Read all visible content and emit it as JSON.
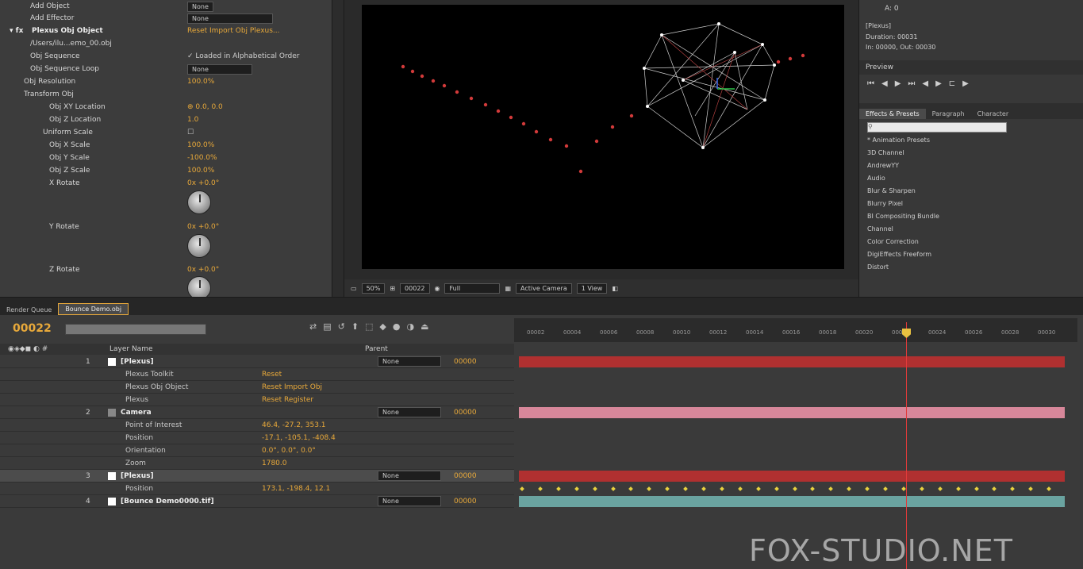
{
  "effect_controls": {
    "top_rows": [
      {
        "name": "Add Object",
        "value": "None"
      },
      {
        "name": "Add Effector",
        "value": "None"
      }
    ],
    "group_title": "Plexus Obj Object",
    "group_value": "Reset   Import Obj   Plexus...",
    "path": "/Users/ilu...emo_00.obj",
    "obj_sequence_label": "Obj Sequence",
    "obj_sequence_value": "Loaded in Alphabetical Order",
    "obj_sequence_loop_label": "Obj Sequence Loop",
    "obj_sequence_loop_value": "None",
    "obj_resolution_label": "Obj Resolution",
    "obj_resolution_value": "100.0%",
    "transform_label": "Transform Obj",
    "xy_loc_label": "Obj XY Location",
    "xy_loc_value": "0.0, 0.0",
    "z_loc_label": "Obj Z Location",
    "z_loc_value": "1.0",
    "uniform_label": "Uniform Scale",
    "x_scale_label": "Obj X Scale",
    "x_scale_value": "100.0%",
    "y_scale_label": "Obj Y Scale",
    "y_scale_value": "-100.0%",
    "z_scale_label": "Obj Z Scale",
    "z_scale_value": "100.0%",
    "x_rotate_label": "X Rotate",
    "x_rotate_value": "0x +0.0°",
    "y_rotate_label": "Y Rotate",
    "y_rotate_value": "0x +0.0°",
    "z_rotate_label": "Z Rotate",
    "z_rotate_value": "0x +0.0°"
  },
  "viewer_toolbar": {
    "zoom": "50%",
    "timecode": "00022",
    "resolution": "Full",
    "camera": "Active Camera",
    "views": "1 View"
  },
  "info": {
    "line0": "A: 0",
    "line1": "[Plexus]",
    "line2": "Duration: 00031",
    "line3": "In: 00000, Out: 00030"
  },
  "preview": {
    "title": "Preview"
  },
  "effects_panel": {
    "tabs": [
      "Effects & Presets",
      "Paragraph",
      "Character"
    ],
    "items": [
      "* Animation Presets",
      "3D Channel",
      "AndrewYY",
      "Audio",
      "Blur & Sharpen",
      "Blurry Pixel",
      "BI Compositing Bundle",
      "Channel",
      "Color Correction",
      "DigiEffects Freeform",
      "Distort"
    ]
  },
  "timeline": {
    "tabs": [
      "Render Queue",
      "Bounce Demo.obj"
    ],
    "timecode": "00022",
    "col_layer_name": "Layer Name",
    "col_parent": "Parent",
    "ruler_ticks": [
      "00002",
      "00004",
      "00006",
      "00008",
      "00010",
      "00012",
      "00014",
      "00016",
      "00018",
      "00020",
      "00022",
      "00024",
      "00026",
      "00028",
      "00030"
    ],
    "layers": [
      {
        "num": "1",
        "name": "[Plexus]",
        "parent": "None",
        "tc": "00000"
      },
      {
        "name": "Plexus Toolkit",
        "value": "Reset"
      },
      {
        "name": "Plexus Obj Object",
        "value": "Reset   Import Obj"
      },
      {
        "name": "Plexus",
        "value": "Reset   Register"
      },
      {
        "num": "2",
        "name": "Camera",
        "parent": "None",
        "tc": "00000"
      },
      {
        "name": "Point of Interest",
        "value": "46.4, -27.2, 353.1"
      },
      {
        "name": "Position",
        "value": "-17.1, -105.1, -408.4"
      },
      {
        "name": "Orientation",
        "value": "0.0°, 0.0°, 0.0°"
      },
      {
        "name": "Zoom",
        "value": "1780.0"
      },
      {
        "num": "3",
        "name": "[Plexus]",
        "parent": "None",
        "tc": "00000"
      },
      {
        "name": "Position",
        "value": "173.1, -198.4, 12.1"
      },
      {
        "num": "4",
        "name": "[Bounce Demo0000.tif]",
        "parent": "None",
        "tc": "00000"
      }
    ]
  },
  "watermark": "FOX-STUDIO.NET",
  "colors": {
    "accent": "#e8a93a",
    "track_red": "#b03030",
    "track_pink": "#d7879a",
    "track_teal": "#6aa3a0"
  }
}
